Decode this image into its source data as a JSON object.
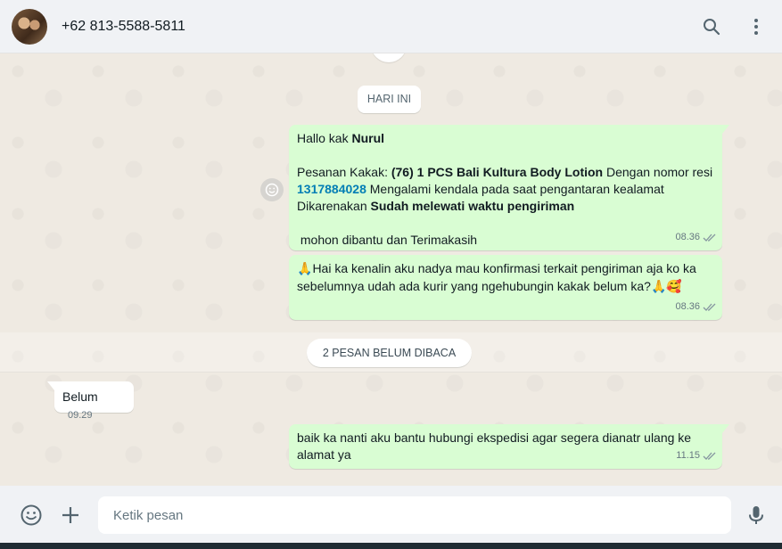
{
  "header": {
    "contact": "+62 813-5588-5811"
  },
  "chat": {
    "date_label": "HARI INI",
    "unread_label": "2 PESAN BELUM DIBACA",
    "messages": {
      "m1": {
        "greet": "Hallo kak ",
        "greet_name": "Nurul",
        "l1_a": "Pesanan Kakak: ",
        "l1_b": "(76) 1 PCS Bali Kultura Body Lotion",
        "l1_c": " Dengan nomor resi",
        "resi": "1317884028",
        "l2_b": " Mengalami kendala pada saat pengantaran kealamat",
        "l3_a": "Dikarenakan ",
        "l3_b": "Sudah melewati waktu pengiriman",
        "l4": " mohon dibantu dan Terimakasih",
        "time": "08.36"
      },
      "m2": {
        "l1": "Hai ka kenalin aku nadya mau konfirmasi terkait pengiriman aja ko ka",
        "l2": "sebelumnya udah ada kurir yang ngehubungin kakak belum ka?",
        "e_pray": "🙏",
        "e_love": "🥰",
        "time": "08.36"
      },
      "m3": {
        "text": "Belum",
        "time": "09.29"
      },
      "m4": {
        "l1": "baik ka nanti aku bantu hubungi ekspedisi agar segera dianatr ulang ke",
        "l2": "alamat ya",
        "time": "11.15"
      }
    }
  },
  "composer": {
    "placeholder": "Ketik pesan"
  },
  "colors": {
    "outgoing": "#d9fdd3",
    "incoming": "#ffffff",
    "link": "#027eb5",
    "background": "#efeae2"
  },
  "icons": [
    "search-icon",
    "menu-icon",
    "emoji-icon",
    "plus-icon",
    "mic-icon",
    "double-check-icon",
    "reaction-icon"
  ]
}
